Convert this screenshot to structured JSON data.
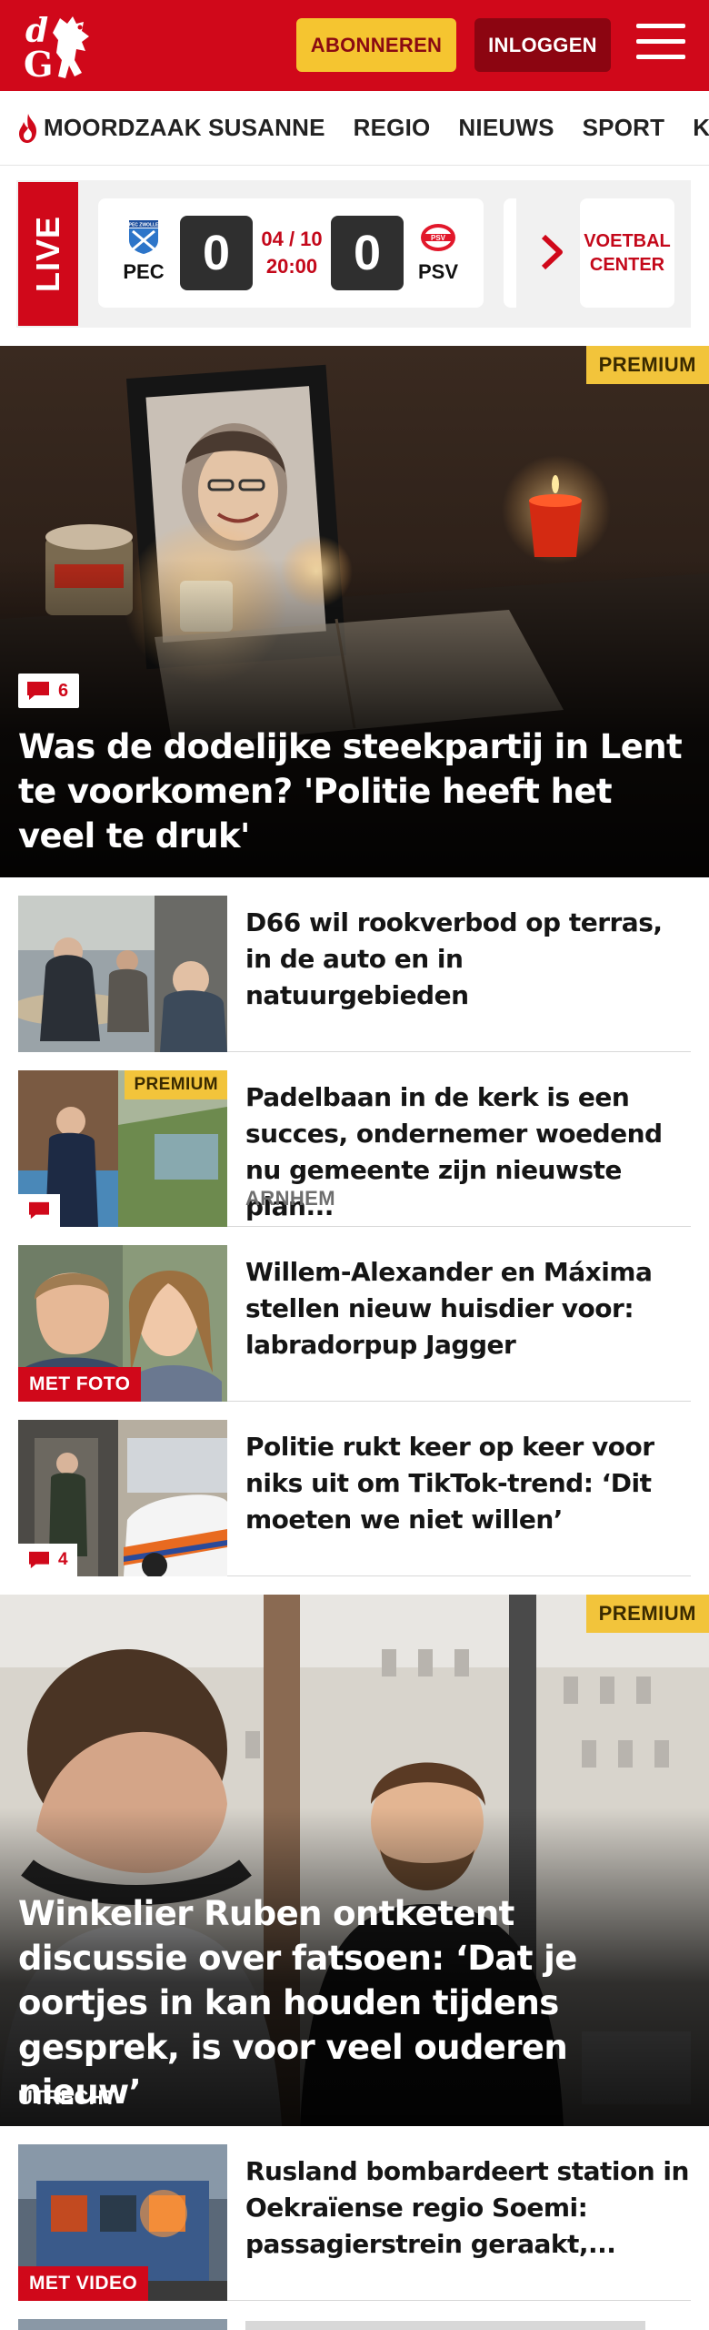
{
  "header": {
    "subscribe_label": "ABONNEREN",
    "login_label": "INLOGGEN",
    "brand_color": "#d0081a"
  },
  "nav": {
    "items": [
      {
        "label": "MOORDZAAK SUSANNE",
        "icon": "flame-icon"
      },
      {
        "label": "REGIO"
      },
      {
        "label": "NIEUWS"
      },
      {
        "label": "SPORT"
      },
      {
        "label": "KIJK"
      }
    ]
  },
  "live": {
    "label": "LIVE",
    "match": {
      "home": "PEC",
      "away": "PSV",
      "home_crest_text": "PEC ZWOLLE",
      "away_crest_text": "PSV",
      "home_score": "0",
      "away_score": "0",
      "date": "04 / 10",
      "time": "20:00"
    },
    "voetbal_center_label": "VOETBAL CENTER"
  },
  "hero1": {
    "premium": "PREMIUM",
    "comments": "6",
    "title": "Was de dodelijke steekpartij in Lent te voorkomen? 'Politie heeft het veel te druk'"
  },
  "articles": [
    {
      "title": "D66 wil rookverbod op terras, in de auto en in natuurgebieden"
    },
    {
      "title": "Padelbaan in de kerk is een succes, ondernemer woedend nu gemeente zijn nieuwste plan...",
      "premium": "PREMIUM",
      "region": "ARNHEM"
    },
    {
      "title": "Willem-Alexander en Máxima stellen nieuw huisdier voor: labradorpup Jagger",
      "tag": "MET FOTO"
    },
    {
      "title": "Politie rukt keer op keer voor niks uit om TikTok-trend: ‘Dit moeten we niet willen’",
      "comments": "4"
    }
  ],
  "hero2": {
    "premium": "PREMIUM",
    "title": "Winkelier Ruben ontketent discussie over fatsoen: ‘Dat je oortjes in kan houden tijdens gesprek, is voor veel ouderen nieuw’",
    "region": "UTRECHT"
  },
  "article_bottom": {
    "title": "Rusland bombardeert station in Oekraïense regio Soemi: passagierstrein geraakt,...",
    "tag": "MET VIDEO"
  }
}
